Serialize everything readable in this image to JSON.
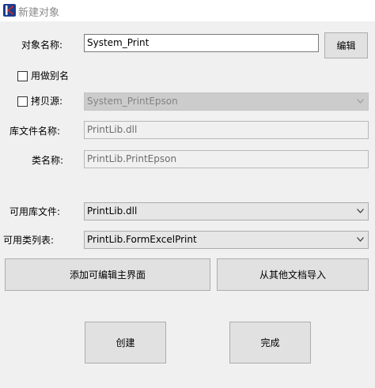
{
  "window": {
    "title": "新建对象",
    "icon": "app-logo-icon"
  },
  "form": {
    "object_name_label": "对象名称:",
    "object_name_value": "System_Print",
    "edit_button": "编辑",
    "use_alias_label": "用做别名",
    "copy_source_label": "拷贝源:",
    "copy_source_value": "System_PrintEpson",
    "lib_file_name_label": "库文件名称:",
    "lib_file_name_value": "PrintLib.dll",
    "class_name_label": "类名称:",
    "class_name_value": "PrintLib.PrintEpson",
    "available_lib_label": "可用库文件:",
    "available_lib_value": "PrintLib.dll",
    "available_class_label": "可用类列表:",
    "available_class_value": "PrintLib.FormExcelPrint"
  },
  "buttons": {
    "add_editable_main": "添加可编辑主界面",
    "import_from_doc": "从其他文档导入",
    "create": "创建",
    "finish": "完成"
  },
  "colors": {
    "background": "#f0f0f0",
    "icon_blue": "#1a3d8f",
    "icon_red": "#d8261c"
  }
}
